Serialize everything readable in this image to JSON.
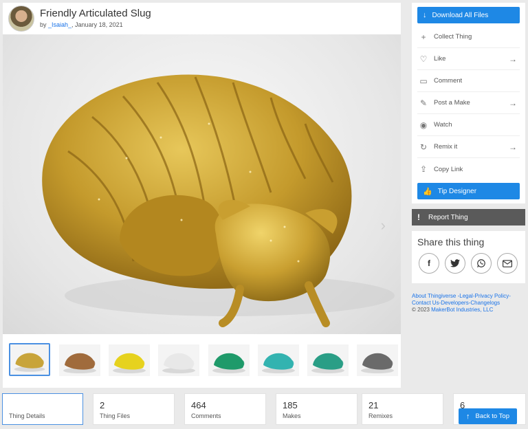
{
  "header": {
    "title": "Friendly Articulated Slug",
    "by_prefix": "by ",
    "author": "_Isaiah_",
    "date": ", January 18, 2021"
  },
  "gallery": {
    "next_icon": "chevron-right-icon",
    "thumbnails": [
      {
        "name": "gold-slug-curled",
        "color": "#c8a43a"
      },
      {
        "name": "brown-slug",
        "color": "#a06b3c"
      },
      {
        "name": "yellow-slug",
        "color": "#e6d21e"
      },
      {
        "name": "white-slug",
        "color": "#e8e8e8"
      },
      {
        "name": "green-slug",
        "color": "#1f9a6a"
      },
      {
        "name": "teal-slug",
        "color": "#33b3b0"
      },
      {
        "name": "green-teal-slugs",
        "color": "#2a9e86"
      },
      {
        "name": "gray-slug",
        "color": "#6a6a6a"
      }
    ]
  },
  "sidebar": {
    "download_label": "Download All Files",
    "actions": [
      {
        "label": "Collect Thing",
        "icon": "plus-icon",
        "arrow": false
      },
      {
        "label": "Like",
        "icon": "heart-icon",
        "arrow": true
      },
      {
        "label": "Comment",
        "icon": "comment-icon",
        "arrow": false
      },
      {
        "label": "Post a Make",
        "icon": "make-icon",
        "arrow": true
      },
      {
        "label": "Watch",
        "icon": "eye-icon",
        "arrow": false
      },
      {
        "label": "Remix it",
        "icon": "remix-icon",
        "arrow": true
      },
      {
        "label": "Copy Link",
        "icon": "share-link-icon",
        "arrow": false
      }
    ],
    "tip_label": "Tip Designer",
    "report_label": "Report Thing"
  },
  "share": {
    "title": "Share this thing",
    "icons": [
      "facebook-icon",
      "twitter-icon",
      "whatsapp-icon",
      "email-icon"
    ]
  },
  "footer": {
    "about": "About Thingiverse",
    "legal": "Legal",
    "privacy": "Privacy Policy",
    "contact": "Contact Us",
    "developers": "Developers",
    "changelogs": "Changelogs",
    "copyright": "©  2023 ",
    "company": "MakerBot Industries, LLC"
  },
  "tabs": [
    {
      "num": "",
      "label": "Thing Details"
    },
    {
      "num": "2",
      "label": "Thing Files"
    },
    {
      "num": "464",
      "label": "Comments"
    },
    {
      "num": "185",
      "label": "Makes"
    },
    {
      "num": "21",
      "label": "Remixes"
    },
    {
      "num": "6",
      "label": ""
    }
  ],
  "back_to_top": "Back to Top",
  "colors": {
    "accent": "#1e88e5",
    "report": "#5a5a5a",
    "filament": "#c8a43a"
  }
}
